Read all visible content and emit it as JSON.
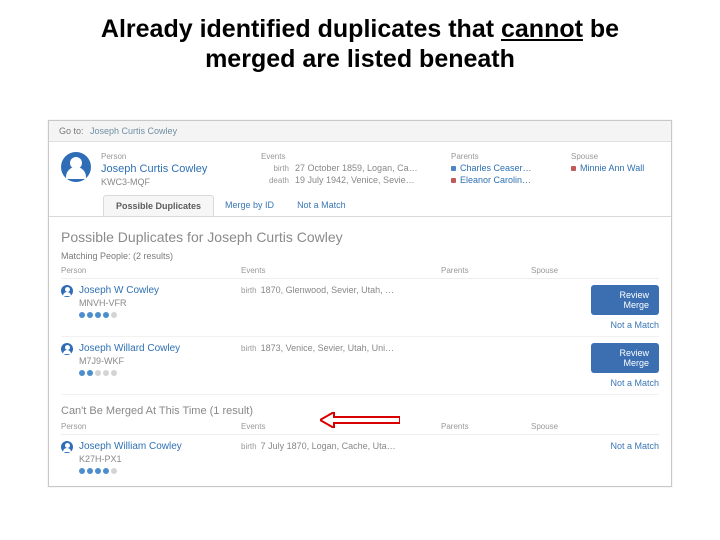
{
  "slide": {
    "title_pre": "Already identified duplicates that ",
    "title_underline": "cannot",
    "title_post": " be merged are listed beneath"
  },
  "goto": {
    "label": "Go to:",
    "name": "Joseph Curtis Cowley"
  },
  "header": {
    "person_label": "Person",
    "name": "Joseph Curtis Cowley",
    "id": "KWC3-MQF",
    "events_label": "Events",
    "birth_label": "birth",
    "birth_value": "27 October 1859, Logan, Ca…",
    "death_label": "death",
    "death_value": "19 July 1942, Venice, Sevie…",
    "parents_label": "Parents",
    "parent1": "Charles Ceaser…",
    "parent2": "Eleanor Carolin…",
    "spouse_label": "Spouse",
    "spouse1": "Minnie Ann Wall"
  },
  "tabs": {
    "t1": "Possible Duplicates",
    "t2": "Merge by ID",
    "t3": "Not a Match"
  },
  "section": {
    "title": "Possible Duplicates for Joseph Curtis Cowley",
    "matching_label": "Matching People:  (2 results)",
    "col_person": "Person",
    "col_events": "Events",
    "col_parents": "Parents",
    "col_spouse": "Spouse",
    "review_btn": "Review Merge",
    "not_a_match": "Not a Match"
  },
  "matches": [
    {
      "name": "Joseph W Cowley",
      "id": "MNVH-VFR",
      "birth_label": "birth",
      "birth_value": "1870, Glenwood, Sevier, Utah, …",
      "dots_on": 4
    },
    {
      "name": "Joseph Willard Cowley",
      "id": "M7J9-WKF",
      "birth_label": "birth",
      "birth_value": "1873, Venice, Sevier, Utah, Uni…",
      "dots_on": 2
    }
  ],
  "cant": {
    "title": "Can't Be Merged At This Time  (1 result)",
    "col_person": "Person",
    "col_events": "Events",
    "col_parents": "Parents",
    "col_spouse": "Spouse",
    "not_a_match": "Not a Match"
  },
  "cant_row": {
    "name": "Joseph William Cowley",
    "id": "K27H-PX1",
    "birth_label": "birth",
    "birth_value": "7 July 1870, Logan, Cache, Uta…",
    "dots_on": 4
  }
}
